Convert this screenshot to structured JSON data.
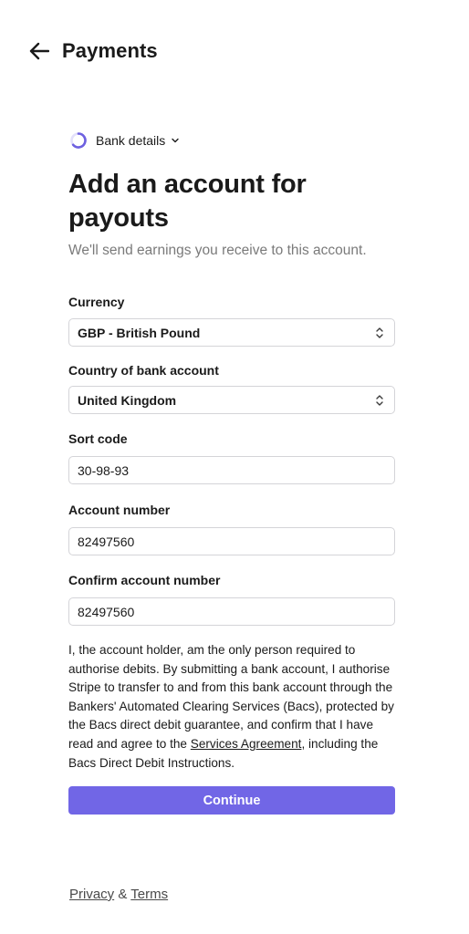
{
  "header": {
    "title": "Payments",
    "back_icon": "arrow-left-icon"
  },
  "step": {
    "label": "Bank details",
    "icon": "progress-ring-icon",
    "chevron": "chevron-down-icon"
  },
  "main": {
    "title": "Add an account for payouts",
    "subtitle": "We'll send earnings you receive to this account."
  },
  "form": {
    "currency": {
      "label": "Currency",
      "value": "GBP - British Pound"
    },
    "country": {
      "label": "Country of bank account",
      "value": "United Kingdom"
    },
    "sort_code": {
      "label": "Sort code",
      "value": "30-98-93"
    },
    "account_number": {
      "label": "Account number",
      "value": "82497560"
    },
    "confirm_account_number": {
      "label": "Confirm account number",
      "value": "82497560"
    }
  },
  "legal": {
    "text_before": "I, the account holder, am the only person required to authorise debits. By submitting a bank account, I authorise Stripe to transfer to and from this bank account through the Bankers' Automated Clearing Services (Bacs), protected by the Bacs direct debit guarantee, and confirm that I have read and agree to the ",
    "link": "Services Agreement",
    "text_after": ", including the Bacs Direct Debit Instructions."
  },
  "continue_label": "Continue",
  "footer": {
    "privacy": "Privacy",
    "separator": " & ",
    "terms": "Terms"
  },
  "colors": {
    "accent": "#7166e6",
    "ring": "#6e61e0",
    "muted_text": "#7a7a7a",
    "border": "#d4d4d8"
  }
}
